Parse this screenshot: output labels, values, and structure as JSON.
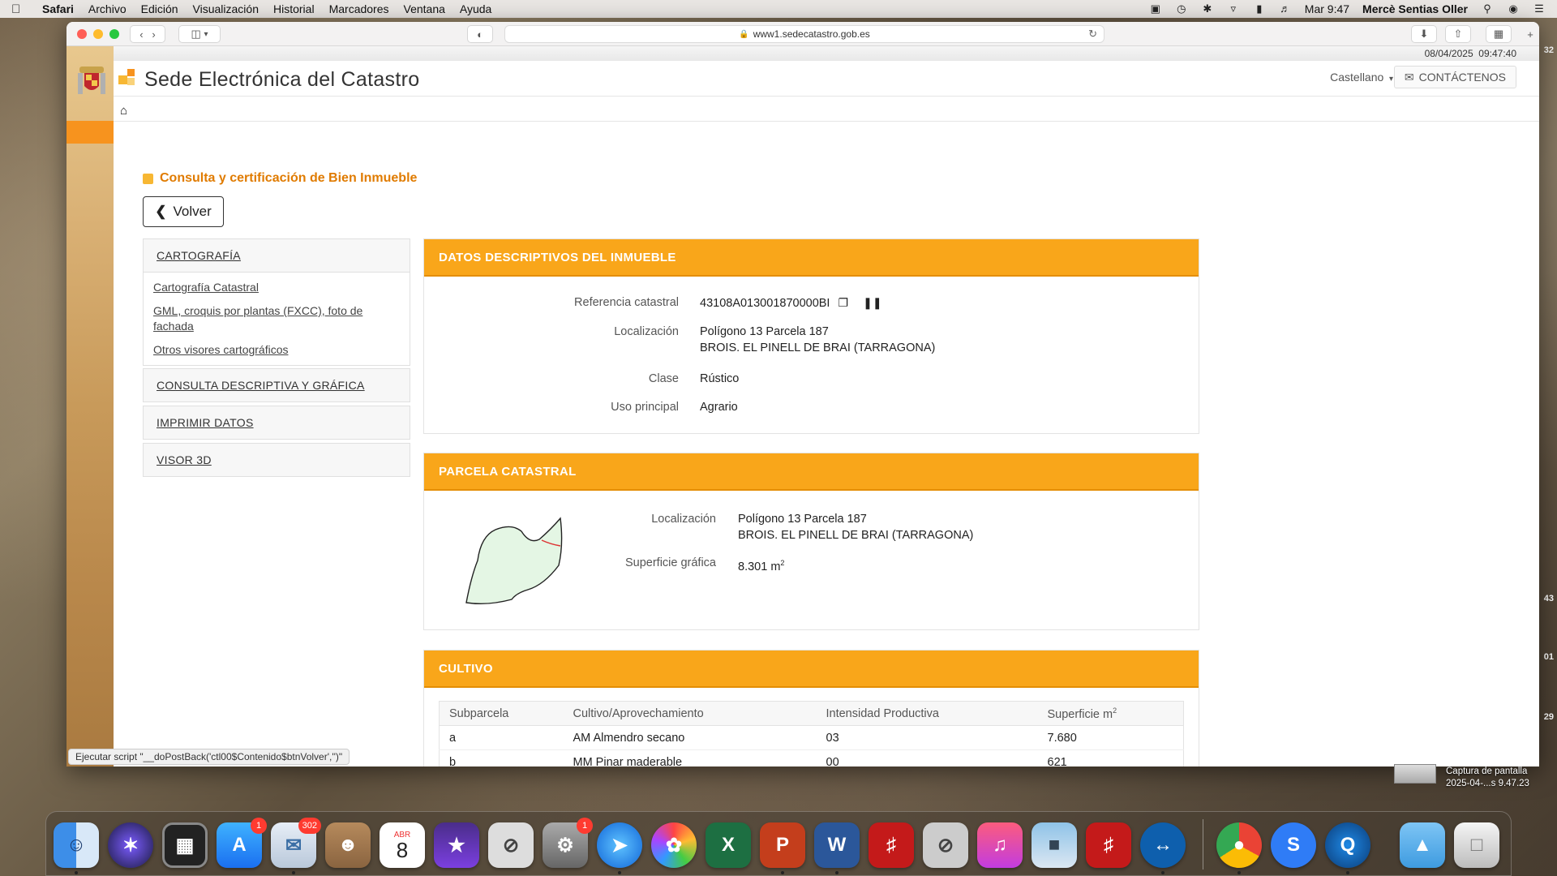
{
  "menubar": {
    "app": "Safari",
    "items": [
      "Archivo",
      "Edición",
      "Visualización",
      "Historial",
      "Marcadores",
      "Ventana",
      "Ayuda"
    ],
    "clock": "Mar 9:47",
    "user": "Mercè Sentias Oller"
  },
  "browser": {
    "url": "www1.sedecatastro.gob.es",
    "status": "Ejecutar script \"__doPostBack('ctl00$Contenido$btnVolver','')\""
  },
  "header": {
    "datetime": "08/04/2025  09:47:40",
    "site_title": "Sede Electrónica del Catastro",
    "language": "Castellano",
    "contact": "CONTÁCTENOS"
  },
  "page": {
    "heading": "Consulta y certificación de Bien Inmueble",
    "back_label": "Volver"
  },
  "sidebar": {
    "cartografia": {
      "title": "CARTOGRAFÍA",
      "items": [
        "Cartografía Catastral",
        "GML, croquis por plantas (FXCC), foto de fachada",
        "Otros visores cartográficos"
      ]
    },
    "consulta": "CONSULTA DESCRIPTIVA Y GRÁFICA",
    "imprimir": "IMPRIMIR DATOS",
    "visor": "VISOR 3D"
  },
  "datos": {
    "title": "DATOS DESCRIPTIVOS DEL INMUEBLE",
    "ref_label": "Referencia catastral",
    "ref_value": "43108A013001870000BI",
    "loc_label": "Localización",
    "loc_line1": "Polígono 13 Parcela 187",
    "loc_line2": "BROIS. EL PINELL DE BRAI (TARRAGONA)",
    "clase_label": "Clase",
    "clase_value": "Rústico",
    "uso_label": "Uso principal",
    "uso_value": "Agrario"
  },
  "parcela": {
    "title": "PARCELA CATASTRAL",
    "loc_label": "Localización",
    "loc_line1": "Polígono 13 Parcela 187",
    "loc_line2": "BROIS. EL PINELL DE BRAI (TARRAGONA)",
    "sup_label": "Superficie gráfica",
    "sup_value": "8.301 m",
    "sup_exp": "2"
  },
  "cultivo": {
    "title": "CULTIVO",
    "headers": [
      "Subparcela",
      "Cultivo/Aprovechamiento",
      "Intensidad Productiva",
      "Superficie m"
    ],
    "header_exp": "2",
    "rows": [
      [
        "a",
        "AM Almendro secano",
        "03",
        "7.680"
      ],
      [
        "b",
        "MM Pinar maderable",
        "00",
        "621"
      ]
    ]
  },
  "desktop": {
    "edge_numbers": [
      "32",
      "43",
      "01",
      "29"
    ],
    "screenshot_label_1": "Captura de pantalla",
    "screenshot_label_2": "2025-04-...s 9.47.23"
  },
  "dock": {
    "calendar_month": "ABR",
    "calendar_day": "8",
    "appstore_badge": "1",
    "mail_badge": "302",
    "settings_badge": "1"
  }
}
